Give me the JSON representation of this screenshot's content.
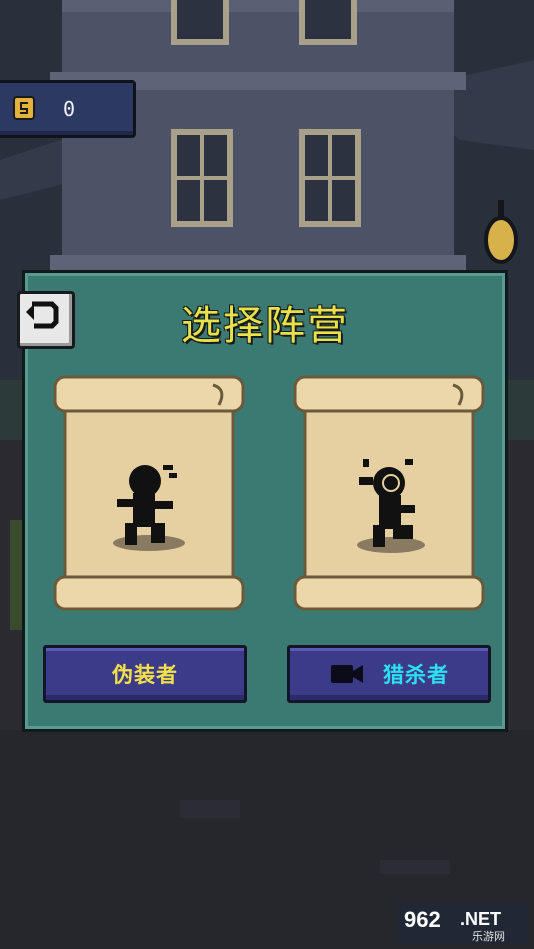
{
  "coins": {
    "count": "0"
  },
  "dialog": {
    "title": "选择阵营",
    "options": [
      {
        "label": "伪装者",
        "label_color": "#f4e04a",
        "has_video_icon": false
      },
      {
        "label": "猎杀者",
        "label_color": "#2de0f0",
        "has_video_icon": true
      }
    ]
  },
  "watermark": {
    "number": "962",
    "suffix": ".NET",
    "sub": "乐游网"
  }
}
